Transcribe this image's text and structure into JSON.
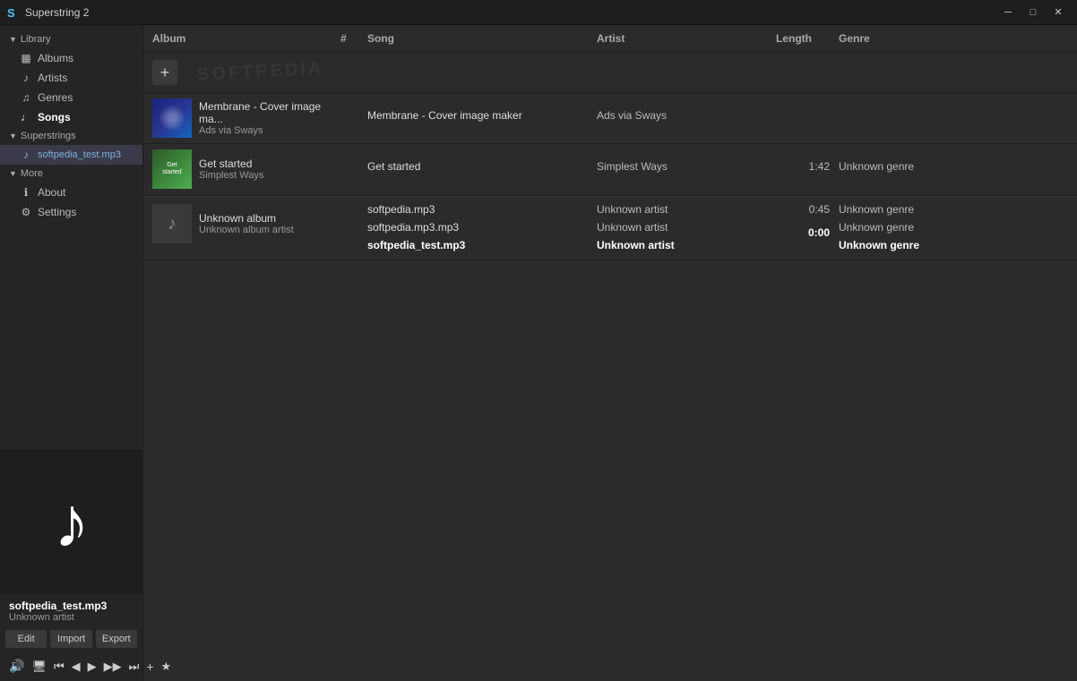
{
  "window": {
    "title": "Superstring 2",
    "icon": "S"
  },
  "titlebar": {
    "minimize": "─",
    "maximize": "□",
    "close": "✕"
  },
  "sidebar": {
    "library_label": "Library",
    "items": [
      {
        "id": "albums",
        "label": "Albums",
        "icon": "▦"
      },
      {
        "id": "artists",
        "label": "Artists",
        "icon": "♪"
      },
      {
        "id": "genres",
        "label": "Genres",
        "icon": "♫"
      },
      {
        "id": "songs",
        "label": "Songs",
        "icon": "♩"
      }
    ],
    "superstrings_label": "Superstrings",
    "files": [
      {
        "id": "file1",
        "label": "softpedia_test.mp3",
        "icon": "♪"
      }
    ],
    "more_label": "More",
    "more_items": [
      {
        "id": "about",
        "label": "About",
        "icon": "ℹ"
      },
      {
        "id": "settings",
        "label": "Settings",
        "icon": "⚙"
      }
    ]
  },
  "now_playing": {
    "title": "softpedia_test.mp3",
    "artist": "Unknown artist",
    "art_icon": "♪"
  },
  "action_buttons": {
    "edit": "Edit",
    "import": "Import",
    "export": "Export"
  },
  "playback": {
    "volume_icon": "🔊",
    "monitor_icon": "🖥",
    "prev_icon": "⏮",
    "back_icon": "◀",
    "play_icon": "▶",
    "forward_icon": "▶▶",
    "next_icon": "⏭",
    "add_icon": "+",
    "star_icon": "★"
  },
  "table": {
    "columns": [
      "Album",
      "#",
      "Song",
      "Artist",
      "Length",
      "Genre"
    ]
  },
  "albums": [
    {
      "id": "membrane",
      "name": "Membrane - Cover image ma...",
      "artist": "Ads via Sways",
      "thumb_type": "membrane",
      "songs": [
        {
          "number": "",
          "name": "Membrane - Cover image maker",
          "artist": "Ads via Sways",
          "length": "",
          "genre": ""
        }
      ]
    },
    {
      "id": "get-started",
      "name": "Get started",
      "artist": "Simplest Ways",
      "thumb_type": "get-started",
      "songs": [
        {
          "number": "",
          "name": "Get started",
          "artist": "Simplest Ways",
          "length": "1:42",
          "genre": "Unknown genre"
        }
      ]
    },
    {
      "id": "unknown-album",
      "name": "Unknown album",
      "artist": "Unknown album artist",
      "thumb_type": "unknown",
      "songs": [
        {
          "number": "",
          "name": "softpedia.mp3",
          "artist": "Unknown artist",
          "length": "0:45",
          "genre": "Unknown genre",
          "selected": false
        },
        {
          "number": "",
          "name": "softpedia.mp3.mp3",
          "artist": "Unknown artist",
          "length": "",
          "genre": "Unknown genre",
          "selected": false
        },
        {
          "number": "",
          "name": "softpedia_test.mp3",
          "artist": "Unknown artist",
          "length": "0:00",
          "genre": "Unknown genre",
          "selected": true,
          "playing": true
        }
      ]
    }
  ],
  "watermark": "SOFTPEDIA"
}
